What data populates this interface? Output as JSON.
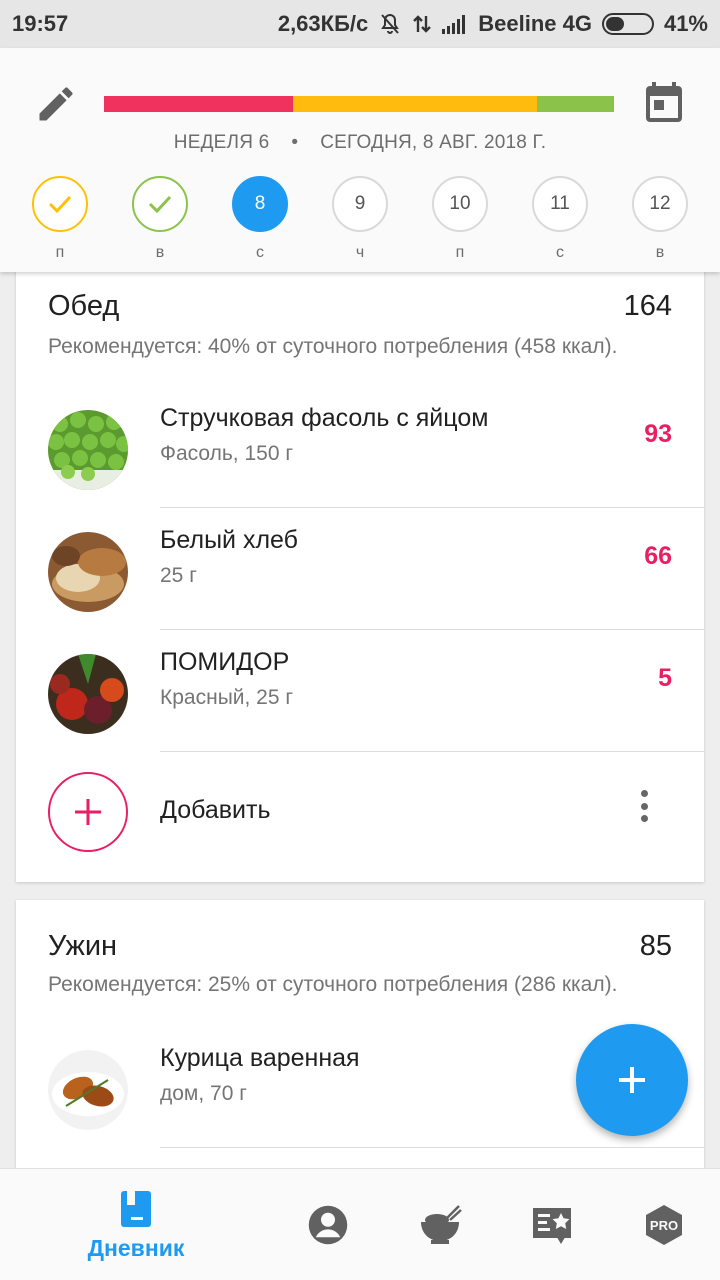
{
  "status_bar": {
    "time": "19:57",
    "speed": "2,63КБ/с",
    "carrier": "Beeline 4G",
    "battery": "41%",
    "battery_level": 0.41
  },
  "header": {
    "progress_segments": [
      {
        "color": "#f0325e",
        "fraction": 0.37
      },
      {
        "color": "#ffbc0f",
        "fraction": 0.48
      },
      {
        "color": "#8bc34a",
        "fraction": 0.15
      }
    ],
    "week_label": "НЕДЕЛЯ 6",
    "separator": "•",
    "date_label": "СЕГОДНЯ, 8 АВГ. 2018 Г.",
    "days": [
      {
        "number": "",
        "label": "п",
        "state": "done-yellow"
      },
      {
        "number": "",
        "label": "в",
        "state": "done-green"
      },
      {
        "number": "8",
        "label": "с",
        "state": "active"
      },
      {
        "number": "9",
        "label": "ч",
        "state": "default"
      },
      {
        "number": "10",
        "label": "п",
        "state": "default"
      },
      {
        "number": "11",
        "label": "с",
        "state": "default"
      },
      {
        "number": "12",
        "label": "в",
        "state": "default"
      }
    ]
  },
  "lunch": {
    "title": "Обед",
    "total": "164",
    "recommendation": "Рекомендуется: 40% от суточного потребления (458 ккал).",
    "items": [
      {
        "name": "Стручковая фасоль с яйцом",
        "detail": "Фасоль, 150 г",
        "calories": "93",
        "image": "green-peas-photo"
      },
      {
        "name": "Белый хлеб",
        "detail": "25 г",
        "calories": "66",
        "image": "bread-photo"
      },
      {
        "name": "ПОМИДОР",
        "detail": "Красный, 25 г",
        "calories": "5",
        "image": "vegetables-photo"
      }
    ],
    "add_label": "Добавить"
  },
  "dinner": {
    "title": "Ужин",
    "total": "85",
    "recommendation": "Рекомендуется: 25% от суточного потребления (286 ккал).",
    "items": [
      {
        "name": "Курица варенная",
        "detail": "дом, 70 г",
        "image": "chicken-photo"
      }
    ]
  },
  "bottom_nav": {
    "diary_label": "Дневник",
    "pro_label": "PRO"
  },
  "colors": {
    "accent": "#1e9bf0",
    "calories": "#e91e63"
  }
}
